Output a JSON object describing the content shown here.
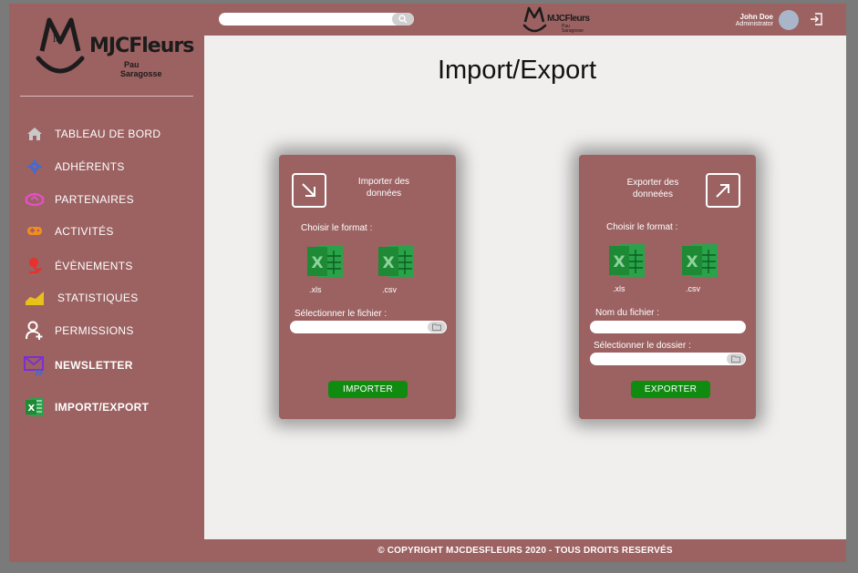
{
  "brand": {
    "name": "MJCFleurs",
    "subtitle_line1": "Pau",
    "subtitle_line2": "Saragosse",
    "logo_letters": "Mla"
  },
  "sidebar": {
    "items": [
      {
        "label": "TABLEAU DE BORD",
        "icon": "home-icon",
        "color": "#c9c9c9"
      },
      {
        "label": "ADHÉRENTS",
        "icon": "gear-group-icon",
        "color": "#3f6bd6"
      },
      {
        "label": "PARTENAIRES",
        "icon": "handshake-icon",
        "color": "#e052c4"
      },
      {
        "label": "ACTIVITÉS",
        "icon": "gamepad-icon",
        "color": "#f28c1c"
      },
      {
        "label": "ÉVÈNEMENTS",
        "icon": "microphone-icon",
        "color": "#e8302c"
      },
      {
        "label": "STATISTIQUES",
        "icon": "chart-icon",
        "color": "#e8c21a"
      },
      {
        "label": "PERMISSIONS",
        "icon": "user-add-icon",
        "color": "#ffffff"
      },
      {
        "label": "NEWSLETTER",
        "icon": "newsletter-icon",
        "color": "#7b2fd6"
      },
      {
        "label": "IMPORT/EXPORT",
        "icon": "excel-icon",
        "color": "#1e8a35"
      }
    ]
  },
  "topbar": {
    "search_placeholder": "",
    "user_name": "John Doe",
    "user_role": "Administrator"
  },
  "main": {
    "title": "Import/Export",
    "import_card": {
      "heading": "Importer des données",
      "format_label": "Choisir le format :",
      "format_xls": ".xls",
      "format_csv": ".csv",
      "file_label": "Sélectionner le fichier :",
      "button": "IMPORTER"
    },
    "export_card": {
      "heading": "Exporter des donneées",
      "format_label": "Choisir le format :",
      "format_xls": ".xls",
      "format_csv": ".csv",
      "filename_label": "Nom du fichier :",
      "folder_label": "Sélectionner le dossier :",
      "button": "EXPORTER"
    }
  },
  "footer": {
    "text": "© COPYRIGHT MJCDESFLEURS 2020 - TOUS DROITS RESERVÉS"
  },
  "colors": {
    "primary": "#9c6161",
    "content_bg": "#f0efee",
    "action_green": "#0f8b0f"
  }
}
